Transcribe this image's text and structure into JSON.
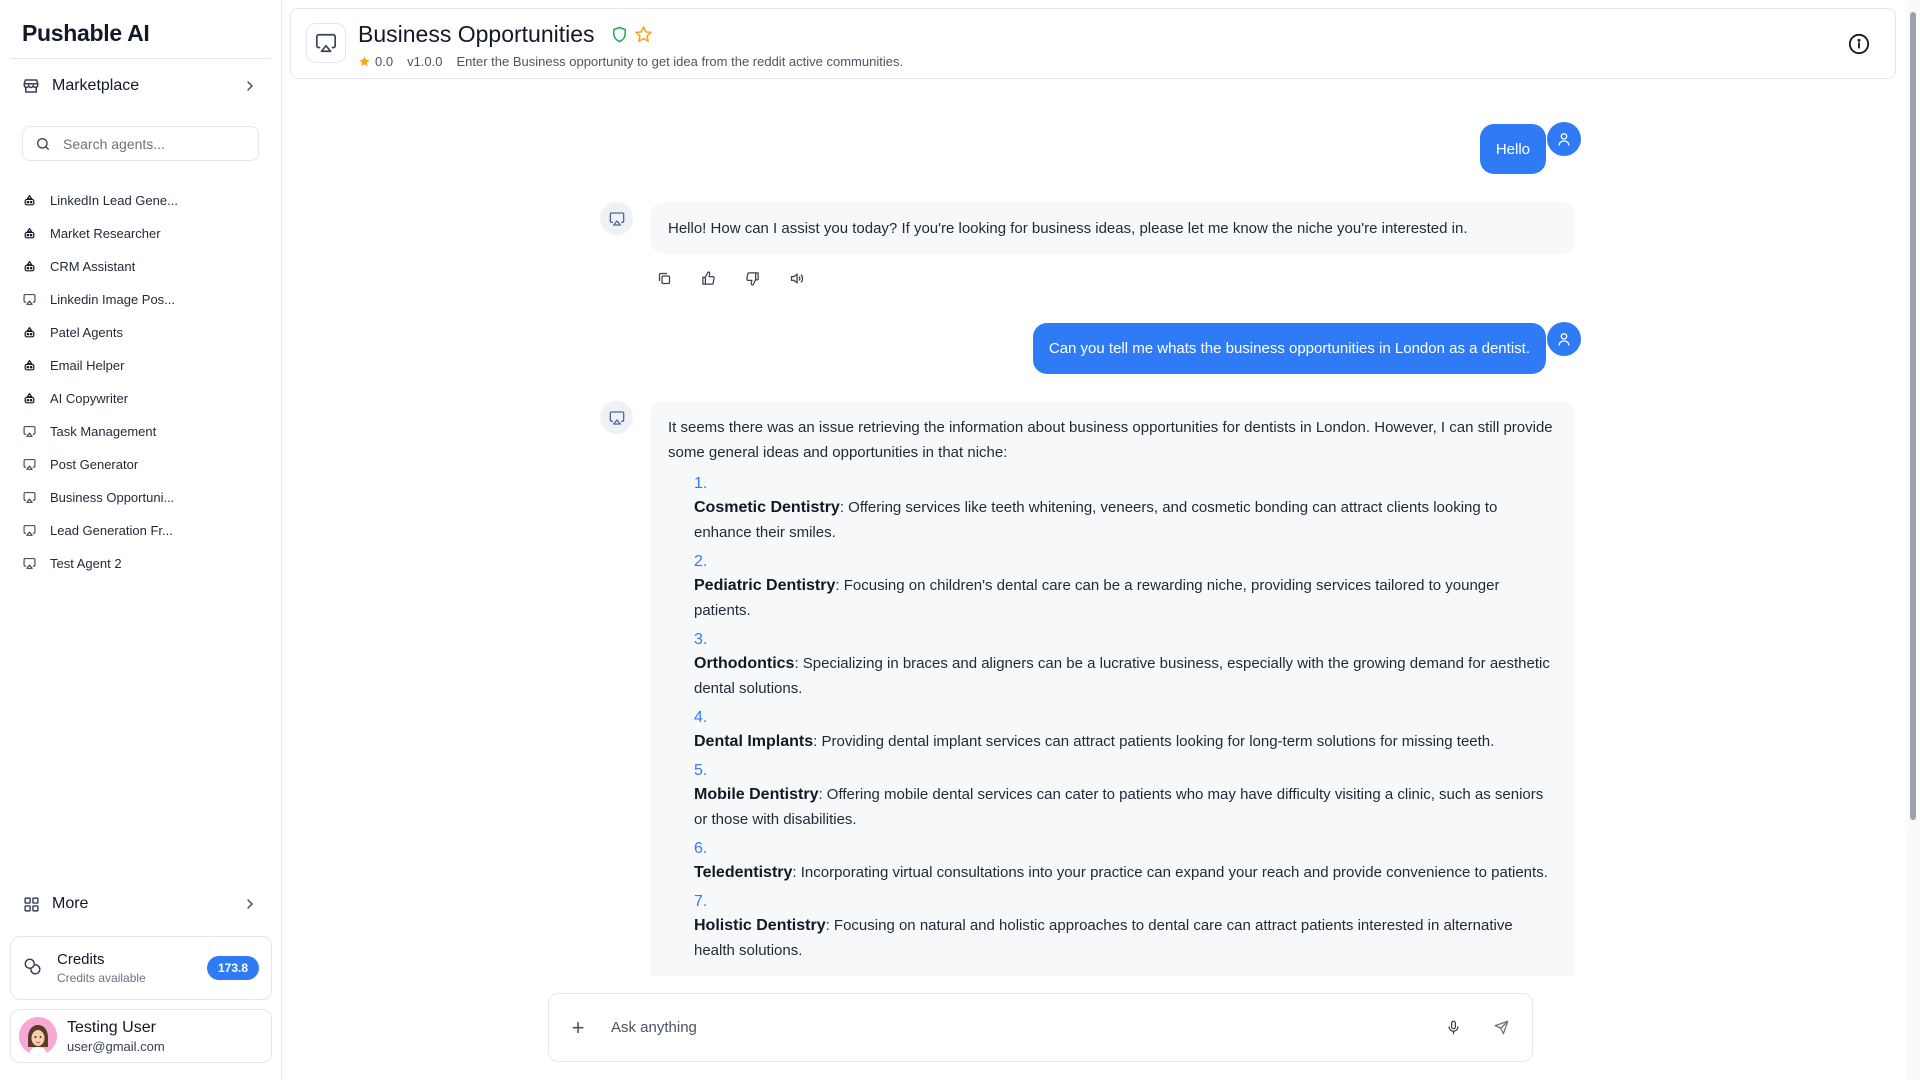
{
  "sidebar": {
    "brand": "Pushable AI",
    "marketplace_label": "Marketplace",
    "search_placeholder": "Search agents...",
    "agents": [
      {
        "label": "LinkedIn Lead Gene...",
        "icon": "robot-icon"
      },
      {
        "label": "Market Researcher",
        "icon": "robot-icon"
      },
      {
        "label": "CRM Assistant",
        "icon": "robot-icon"
      },
      {
        "label": "Linkedin Image Pos...",
        "icon": "monitor-icon"
      },
      {
        "label": "Patel Agents",
        "icon": "robot-icon"
      },
      {
        "label": "Email Helper",
        "icon": "robot-icon"
      },
      {
        "label": "AI Copywriter",
        "icon": "robot-icon"
      },
      {
        "label": "Task Management",
        "icon": "monitor-icon"
      },
      {
        "label": "Post Generator",
        "icon": "monitor-icon"
      },
      {
        "label": "Business Opportuni...",
        "icon": "monitor-icon"
      },
      {
        "label": "Lead Generation Fr...",
        "icon": "monitor-icon"
      },
      {
        "label": "Test Agent 2",
        "icon": "monitor-icon"
      }
    ],
    "more_label": "More",
    "credits": {
      "title": "Credits",
      "subtitle": "Credits available",
      "amount": "173.8"
    },
    "user": {
      "name": "Testing User",
      "email": "user@gmail.com"
    }
  },
  "header": {
    "title": "Business Opportunities",
    "rating": "0.0",
    "version": "v1.0.0",
    "description": "Enter the Business opportunity to get idea from the reddit active communities."
  },
  "chat": {
    "messages": [
      {
        "role": "user",
        "text": "Hello"
      },
      {
        "role": "assistant",
        "text": "Hello! How can I assist you today? If you're looking for business ideas, please let me know the niche you're interested in."
      },
      {
        "role": "user",
        "text": "Can you tell me whats the business opportunities in London as a dentist."
      },
      {
        "role": "assistant",
        "intro": "It seems there was an issue retrieving the information about business opportunities for dentists in London. However, I can still provide some general ideas and opportunities in that niche:",
        "items": [
          {
            "num": "1.",
            "term": "Cosmetic Dentistry",
            "text": ": Offering services like teeth whitening, veneers, and cosmetic bonding can attract clients looking to enhance their smiles."
          },
          {
            "num": "2.",
            "term": "Pediatric Dentistry",
            "text": ": Focusing on children's dental care can be a rewarding niche, providing services tailored to younger patients."
          },
          {
            "num": "3.",
            "term": "Orthodontics",
            "text": ": Specializing in braces and aligners can be a lucrative business, especially with the growing demand for aesthetic dental solutions."
          },
          {
            "num": "4.",
            "term": "Dental Implants",
            "text": ": Providing dental implant services can attract patients looking for long-term solutions for missing teeth."
          },
          {
            "num": "5.",
            "term": "Mobile Dentistry",
            "text": ": Offering mobile dental services can cater to patients who may have difficulty visiting a clinic, such as seniors or those with disabilities."
          },
          {
            "num": "6.",
            "term": "Teledentistry",
            "text": ": Incorporating virtual consultations into your practice can expand your reach and provide convenience to patients."
          },
          {
            "num": "7.",
            "term": "Holistic Dentistry",
            "text": ": Focusing on natural and holistic approaches to dental care can attract patients interested in alternative health solutions."
          }
        ]
      }
    ]
  },
  "composer": {
    "placeholder": "Ask anything"
  },
  "colors": {
    "accent": "#2f7bf5",
    "verified": "#16a34a",
    "star": "#f5a623"
  }
}
